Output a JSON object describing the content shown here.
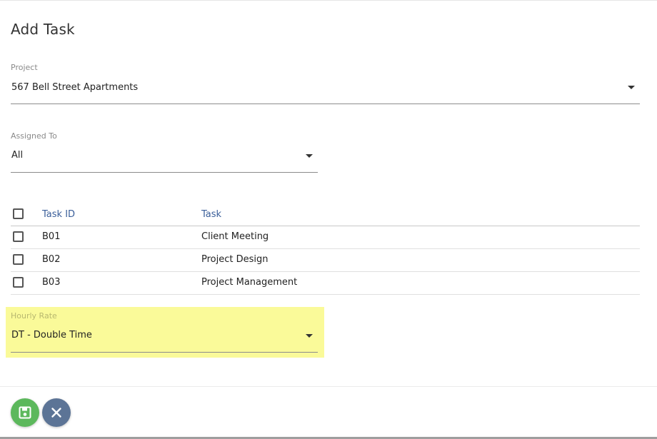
{
  "dialog": {
    "title": "Add Task"
  },
  "project": {
    "label": "Project",
    "value": "567 Bell Street Apartments"
  },
  "assigned_to": {
    "label": "Assigned To",
    "value": "All"
  },
  "table": {
    "headers": {
      "task_id": "Task ID",
      "task": "Task"
    },
    "rows": [
      {
        "task_id": "B01",
        "task": "Client Meeting",
        "checked": false
      },
      {
        "task_id": "B02",
        "task": "Project Design",
        "checked": false
      },
      {
        "task_id": "B03",
        "task": "Project Management",
        "checked": false
      }
    ]
  },
  "hourly_rate": {
    "label": "Hourly Rate",
    "value": "DT - Double Time",
    "highlighted": true,
    "highlight_color": "#fafa99"
  },
  "actions": {
    "save_icon": "floppy-disk-icon",
    "cancel_icon": "close-icon",
    "save_color": "#5cb85c",
    "cancel_color": "#5c7496"
  }
}
